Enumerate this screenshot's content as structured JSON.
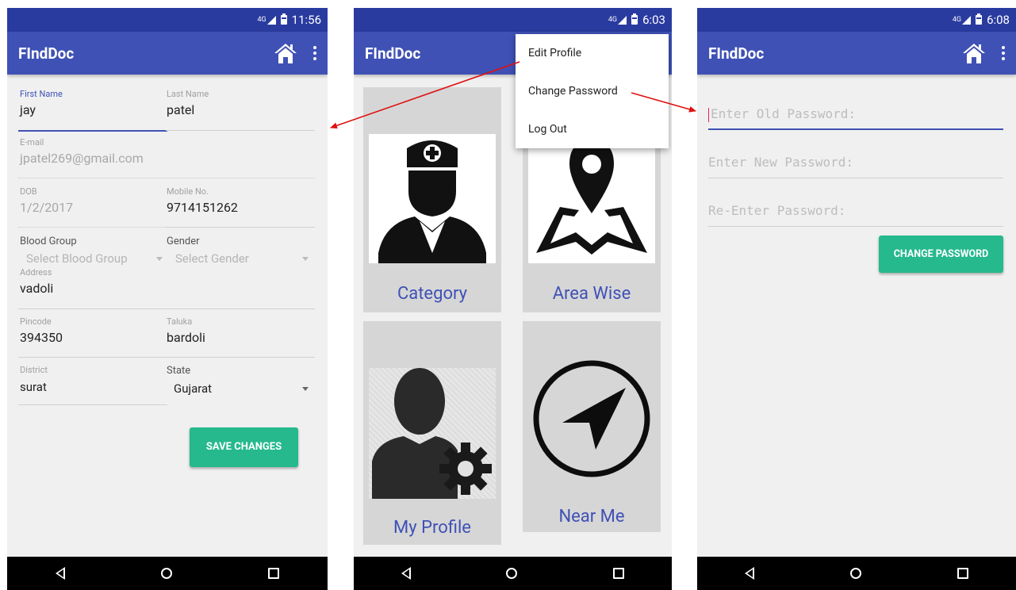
{
  "screens": [
    {
      "status": {
        "time": "11:56",
        "network": "4G"
      },
      "appbar": {
        "title": "FIndDoc"
      },
      "form": {
        "first_name": {
          "label": "First Name",
          "value": "jay"
        },
        "last_name": {
          "label": "Last Name",
          "value": "patel"
        },
        "email": {
          "label": "E-mail",
          "value": "jpatel269@gmail.com"
        },
        "dob": {
          "label": "DOB",
          "value": "1/2/2017"
        },
        "mobile": {
          "label": "Mobile No.",
          "value": "9714151262"
        },
        "blood_group": {
          "label": "Blood Group",
          "value": "Select Blood Group"
        },
        "gender": {
          "label": "Gender",
          "value": "Select Gender"
        },
        "address": {
          "label": "Address",
          "value": "vadoli"
        },
        "pincode": {
          "label": "Pincode",
          "value": "394350"
        },
        "taluka": {
          "label": "Taluka",
          "value": "bardoli"
        },
        "district": {
          "label": "District",
          "value": "surat"
        },
        "state": {
          "label": "State",
          "value": "Gujarat"
        },
        "save_label": "SAVE CHANGES"
      }
    },
    {
      "status": {
        "time": "6:03",
        "network": "4G"
      },
      "appbar": {
        "title": "FIndDoc"
      },
      "tiles": [
        "Category",
        "Area Wise",
        "My Profile",
        "Near Me"
      ],
      "menu": [
        "Edit Profile",
        "Change Password",
        "Log Out"
      ]
    },
    {
      "status": {
        "time": "6:08",
        "network": "4G"
      },
      "appbar": {
        "title": "FIndDoc"
      },
      "fields": {
        "old_placeholder": "Enter Old Password:",
        "new_placeholder": "Enter New Password:",
        "reenter_placeholder": "Re-Enter Password:"
      },
      "button_label": "CHANGE PASSWORD"
    }
  ],
  "colors": {
    "primary": "#3f51b5",
    "status": "#2a3ba0",
    "accent": "#26b98d",
    "annotation": "#e01010"
  }
}
